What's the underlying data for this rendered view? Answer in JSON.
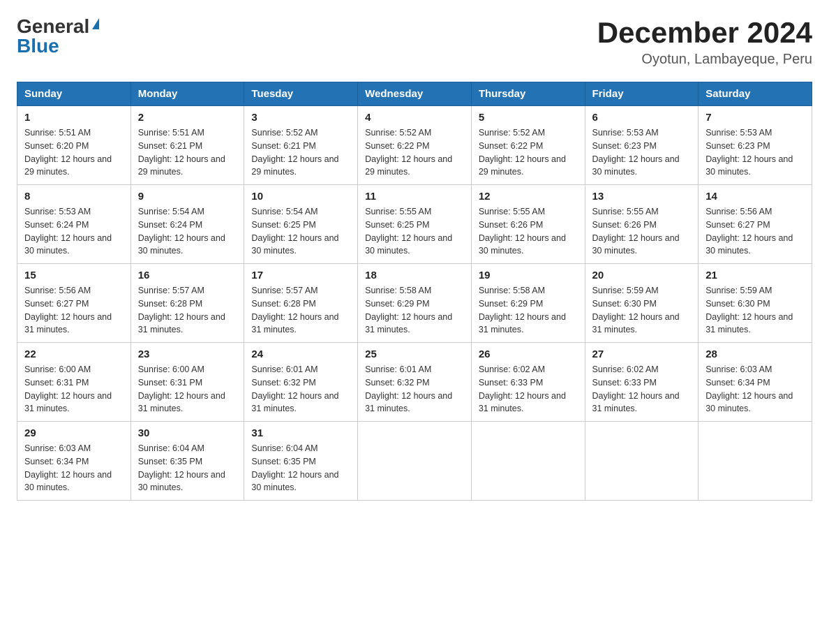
{
  "header": {
    "logo_general": "General",
    "logo_blue": "Blue",
    "title": "December 2024",
    "subtitle": "Oyotun, Lambayeque, Peru"
  },
  "columns": [
    "Sunday",
    "Monday",
    "Tuesday",
    "Wednesday",
    "Thursday",
    "Friday",
    "Saturday"
  ],
  "weeks": [
    [
      {
        "day": "1",
        "sunrise": "Sunrise: 5:51 AM",
        "sunset": "Sunset: 6:20 PM",
        "daylight": "Daylight: 12 hours and 29 minutes."
      },
      {
        "day": "2",
        "sunrise": "Sunrise: 5:51 AM",
        "sunset": "Sunset: 6:21 PM",
        "daylight": "Daylight: 12 hours and 29 minutes."
      },
      {
        "day": "3",
        "sunrise": "Sunrise: 5:52 AM",
        "sunset": "Sunset: 6:21 PM",
        "daylight": "Daylight: 12 hours and 29 minutes."
      },
      {
        "day": "4",
        "sunrise": "Sunrise: 5:52 AM",
        "sunset": "Sunset: 6:22 PM",
        "daylight": "Daylight: 12 hours and 29 minutes."
      },
      {
        "day": "5",
        "sunrise": "Sunrise: 5:52 AM",
        "sunset": "Sunset: 6:22 PM",
        "daylight": "Daylight: 12 hours and 29 minutes."
      },
      {
        "day": "6",
        "sunrise": "Sunrise: 5:53 AM",
        "sunset": "Sunset: 6:23 PM",
        "daylight": "Daylight: 12 hours and 30 minutes."
      },
      {
        "day": "7",
        "sunrise": "Sunrise: 5:53 AM",
        "sunset": "Sunset: 6:23 PM",
        "daylight": "Daylight: 12 hours and 30 minutes."
      }
    ],
    [
      {
        "day": "8",
        "sunrise": "Sunrise: 5:53 AM",
        "sunset": "Sunset: 6:24 PM",
        "daylight": "Daylight: 12 hours and 30 minutes."
      },
      {
        "day": "9",
        "sunrise": "Sunrise: 5:54 AM",
        "sunset": "Sunset: 6:24 PM",
        "daylight": "Daylight: 12 hours and 30 minutes."
      },
      {
        "day": "10",
        "sunrise": "Sunrise: 5:54 AM",
        "sunset": "Sunset: 6:25 PM",
        "daylight": "Daylight: 12 hours and 30 minutes."
      },
      {
        "day": "11",
        "sunrise": "Sunrise: 5:55 AM",
        "sunset": "Sunset: 6:25 PM",
        "daylight": "Daylight: 12 hours and 30 minutes."
      },
      {
        "day": "12",
        "sunrise": "Sunrise: 5:55 AM",
        "sunset": "Sunset: 6:26 PM",
        "daylight": "Daylight: 12 hours and 30 minutes."
      },
      {
        "day": "13",
        "sunrise": "Sunrise: 5:55 AM",
        "sunset": "Sunset: 6:26 PM",
        "daylight": "Daylight: 12 hours and 30 minutes."
      },
      {
        "day": "14",
        "sunrise": "Sunrise: 5:56 AM",
        "sunset": "Sunset: 6:27 PM",
        "daylight": "Daylight: 12 hours and 30 minutes."
      }
    ],
    [
      {
        "day": "15",
        "sunrise": "Sunrise: 5:56 AM",
        "sunset": "Sunset: 6:27 PM",
        "daylight": "Daylight: 12 hours and 31 minutes."
      },
      {
        "day": "16",
        "sunrise": "Sunrise: 5:57 AM",
        "sunset": "Sunset: 6:28 PM",
        "daylight": "Daylight: 12 hours and 31 minutes."
      },
      {
        "day": "17",
        "sunrise": "Sunrise: 5:57 AM",
        "sunset": "Sunset: 6:28 PM",
        "daylight": "Daylight: 12 hours and 31 minutes."
      },
      {
        "day": "18",
        "sunrise": "Sunrise: 5:58 AM",
        "sunset": "Sunset: 6:29 PM",
        "daylight": "Daylight: 12 hours and 31 minutes."
      },
      {
        "day": "19",
        "sunrise": "Sunrise: 5:58 AM",
        "sunset": "Sunset: 6:29 PM",
        "daylight": "Daylight: 12 hours and 31 minutes."
      },
      {
        "day": "20",
        "sunrise": "Sunrise: 5:59 AM",
        "sunset": "Sunset: 6:30 PM",
        "daylight": "Daylight: 12 hours and 31 minutes."
      },
      {
        "day": "21",
        "sunrise": "Sunrise: 5:59 AM",
        "sunset": "Sunset: 6:30 PM",
        "daylight": "Daylight: 12 hours and 31 minutes."
      }
    ],
    [
      {
        "day": "22",
        "sunrise": "Sunrise: 6:00 AM",
        "sunset": "Sunset: 6:31 PM",
        "daylight": "Daylight: 12 hours and 31 minutes."
      },
      {
        "day": "23",
        "sunrise": "Sunrise: 6:00 AM",
        "sunset": "Sunset: 6:31 PM",
        "daylight": "Daylight: 12 hours and 31 minutes."
      },
      {
        "day": "24",
        "sunrise": "Sunrise: 6:01 AM",
        "sunset": "Sunset: 6:32 PM",
        "daylight": "Daylight: 12 hours and 31 minutes."
      },
      {
        "day": "25",
        "sunrise": "Sunrise: 6:01 AM",
        "sunset": "Sunset: 6:32 PM",
        "daylight": "Daylight: 12 hours and 31 minutes."
      },
      {
        "day": "26",
        "sunrise": "Sunrise: 6:02 AM",
        "sunset": "Sunset: 6:33 PM",
        "daylight": "Daylight: 12 hours and 31 minutes."
      },
      {
        "day": "27",
        "sunrise": "Sunrise: 6:02 AM",
        "sunset": "Sunset: 6:33 PM",
        "daylight": "Daylight: 12 hours and 31 minutes."
      },
      {
        "day": "28",
        "sunrise": "Sunrise: 6:03 AM",
        "sunset": "Sunset: 6:34 PM",
        "daylight": "Daylight: 12 hours and 30 minutes."
      }
    ],
    [
      {
        "day": "29",
        "sunrise": "Sunrise: 6:03 AM",
        "sunset": "Sunset: 6:34 PM",
        "daylight": "Daylight: 12 hours and 30 minutes."
      },
      {
        "day": "30",
        "sunrise": "Sunrise: 6:04 AM",
        "sunset": "Sunset: 6:35 PM",
        "daylight": "Daylight: 12 hours and 30 minutes."
      },
      {
        "day": "31",
        "sunrise": "Sunrise: 6:04 AM",
        "sunset": "Sunset: 6:35 PM",
        "daylight": "Daylight: 12 hours and 30 minutes."
      },
      null,
      null,
      null,
      null
    ]
  ]
}
